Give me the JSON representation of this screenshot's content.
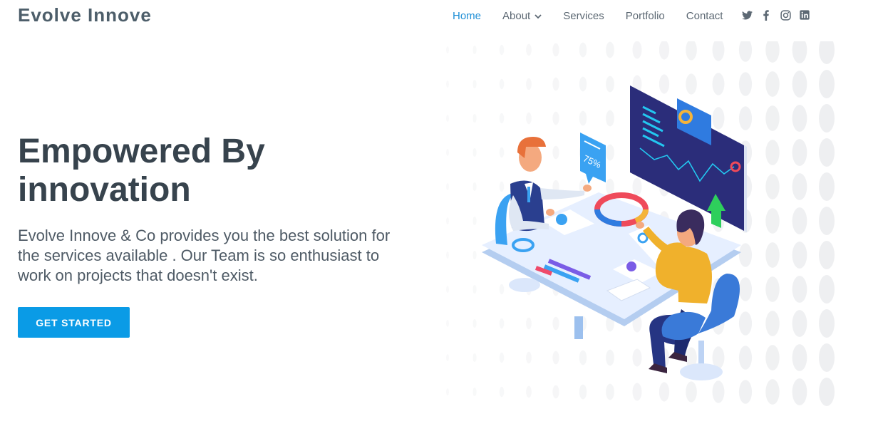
{
  "brand": {
    "name": "Evolve Innove"
  },
  "nav": {
    "items": [
      {
        "label": "Home",
        "active": true
      },
      {
        "label": "About",
        "has_dropdown": true
      },
      {
        "label": "Services"
      },
      {
        "label": "Portfolio"
      },
      {
        "label": "Contact"
      }
    ],
    "socials": [
      "twitter-icon",
      "facebook-icon",
      "instagram-icon",
      "linkedin-icon"
    ]
  },
  "hero": {
    "title": "Empowered By innovation",
    "description": "Evolve Innove & Co provides you the best solution for the services available . Our Team is so enthusiast to work on projects that doesn't exist.",
    "cta_label": "GET STARTED",
    "illustration": {
      "badge_text": "75%"
    }
  },
  "colors": {
    "brand_text": "#4d5e6a",
    "nav_active": "#1f8fd6",
    "cta_background": "#0a9be6",
    "heading_text": "#37434d"
  }
}
